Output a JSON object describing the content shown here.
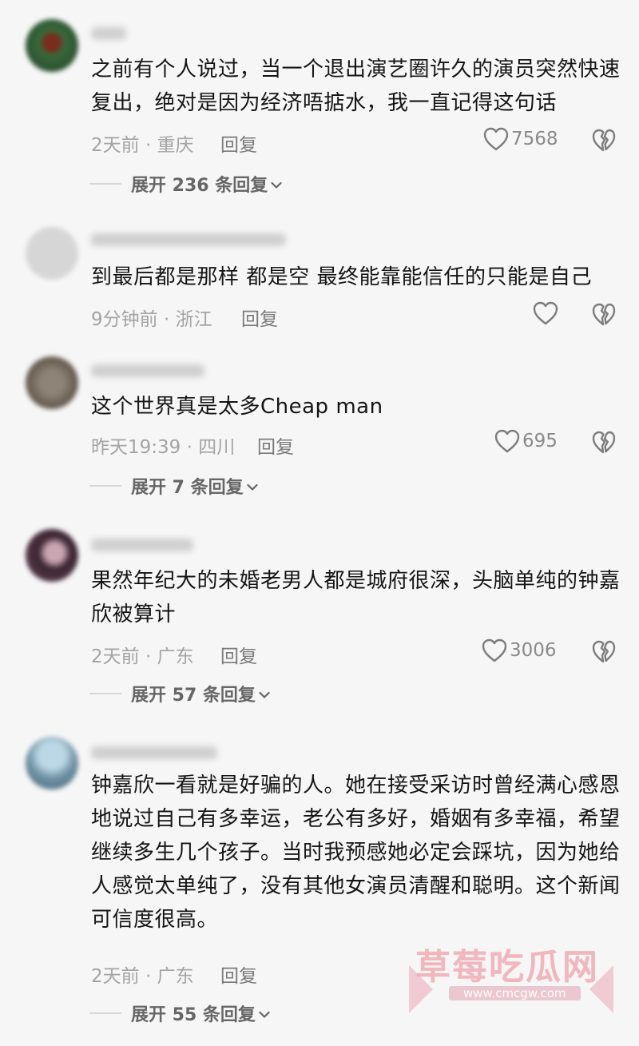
{
  "comments": [
    {
      "text": "之前有个人说过，当一个退出演艺圈许久的演员突然快速复出，绝对是因为经济唔掂水，我一直记得这句话",
      "time": "2天前",
      "location": "重庆",
      "reply_label": "回复",
      "likes": "7568",
      "expand_label": "展开 236 条回复"
    },
    {
      "text": "到最后都是那样 都是空 最终能靠能信任的只能是自己",
      "time": "9分钟前",
      "location": "浙江",
      "reply_label": "回复",
      "likes": "",
      "expand_label": ""
    },
    {
      "text": "这个世界真是太多Cheap man",
      "time": "昨天19:39",
      "location": "四川",
      "reply_label": "回复",
      "likes": "695",
      "expand_label": "展开 7 条回复"
    },
    {
      "text": "果然年纪大的未婚老男人都是城府很深，头脑单纯的钟嘉欣被算计",
      "time": "2天前",
      "location": "广东",
      "reply_label": "回复",
      "likes": "3006",
      "expand_label": "展开 57 条回复"
    },
    {
      "text": "钟嘉欣一看就是好骗的人。她在接受采访时曾经满心感恩地说过自己有多幸运，老公有多好，婚姻有多幸福，希望继续多生几个孩子。当时我预感她必定会踩坑，因为她给人感觉太单纯了，没有其他女演员清醒和聪明。这个新闻可信度很高。",
      "time": "2天前",
      "location": "广东",
      "reply_label": "回复",
      "likes": "",
      "expand_label": "展开 55 条回复"
    }
  ],
  "separator": "·",
  "watermark": {
    "main": "草莓吃瓜网",
    "sub": "www.cmcgw.com"
  },
  "icons": {
    "like": "heart-outline-icon",
    "dislike": "broken-heart-icon",
    "expand": "chevron-down-icon"
  },
  "colors": {
    "background": "#f6f6f6",
    "text": "#151515",
    "meta": "#a4a4a4",
    "watermark": "#f0a0aa"
  }
}
